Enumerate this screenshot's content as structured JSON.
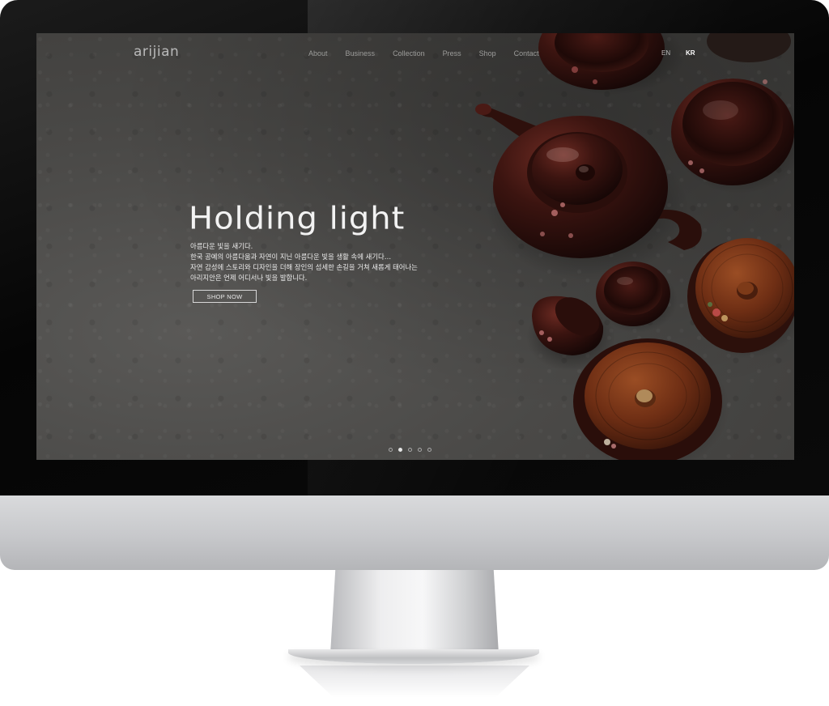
{
  "site": {
    "logo": "arijian",
    "nav": [
      "About",
      "Business",
      "Collection",
      "Press",
      "Shop",
      "Contact"
    ],
    "languages": {
      "en": "EN",
      "kr": "KR",
      "active": "KR"
    }
  },
  "hero": {
    "title": "Holding light",
    "description": [
      "아름다운 빛을 새기다.",
      "한국 공예의 아름다움과 자연이 지닌 아름다운 빛을 생활 속에 새기다…",
      "자연 감성에 스토리와 디자인을 더해 장인의 섬세한 손길을 거쳐 새롭게 태어나는",
      "아리지안은 언제 어디서나 빛을 발합니다."
    ],
    "button": "SHOP NOW"
  },
  "slider": {
    "count": 5,
    "active_index": 1
  },
  "colors": {
    "background": "#4a4947",
    "lacquer": "#3a1410",
    "wood": "#7a3a1a",
    "text": "#f2f2f2"
  },
  "icons": [
    "teapot-image",
    "bowl-image",
    "lidded-bowl-image",
    "slider-dot-icon"
  ]
}
